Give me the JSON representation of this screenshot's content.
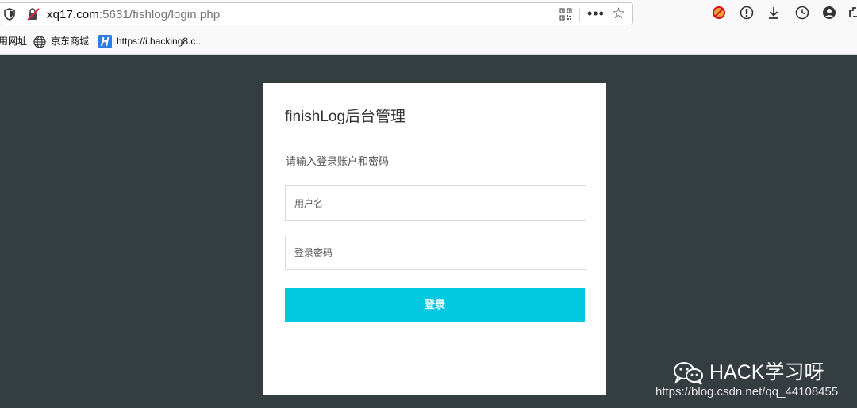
{
  "browser": {
    "url_host": "xq17.com",
    "url_rest": ":5631/fishlog/login.php",
    "more_label": "•••",
    "star_label": "☆",
    "toolbar_icons": [
      "blocked-addon-icon",
      "info-icon",
      "download-icon",
      "history-icon",
      "account-icon",
      "overflow-icon"
    ]
  },
  "bookmarks": [
    {
      "label": "用网址",
      "icon": "none"
    },
    {
      "label": "京东商城",
      "icon": "globe-icon"
    },
    {
      "label": "https://i.hacking8.c...",
      "icon": "hacking8-icon"
    }
  ],
  "login": {
    "title": "finishLog后台管理",
    "subtitle": "请输入登录账户和密码",
    "username_placeholder": "用户名",
    "password_placeholder": "登录密码",
    "submit_label": "登录",
    "accent_color": "#02c9e0"
  },
  "watermark": {
    "brand": "HACK学习呀",
    "url": "https://blog.csdn.net/qq_44108455"
  }
}
